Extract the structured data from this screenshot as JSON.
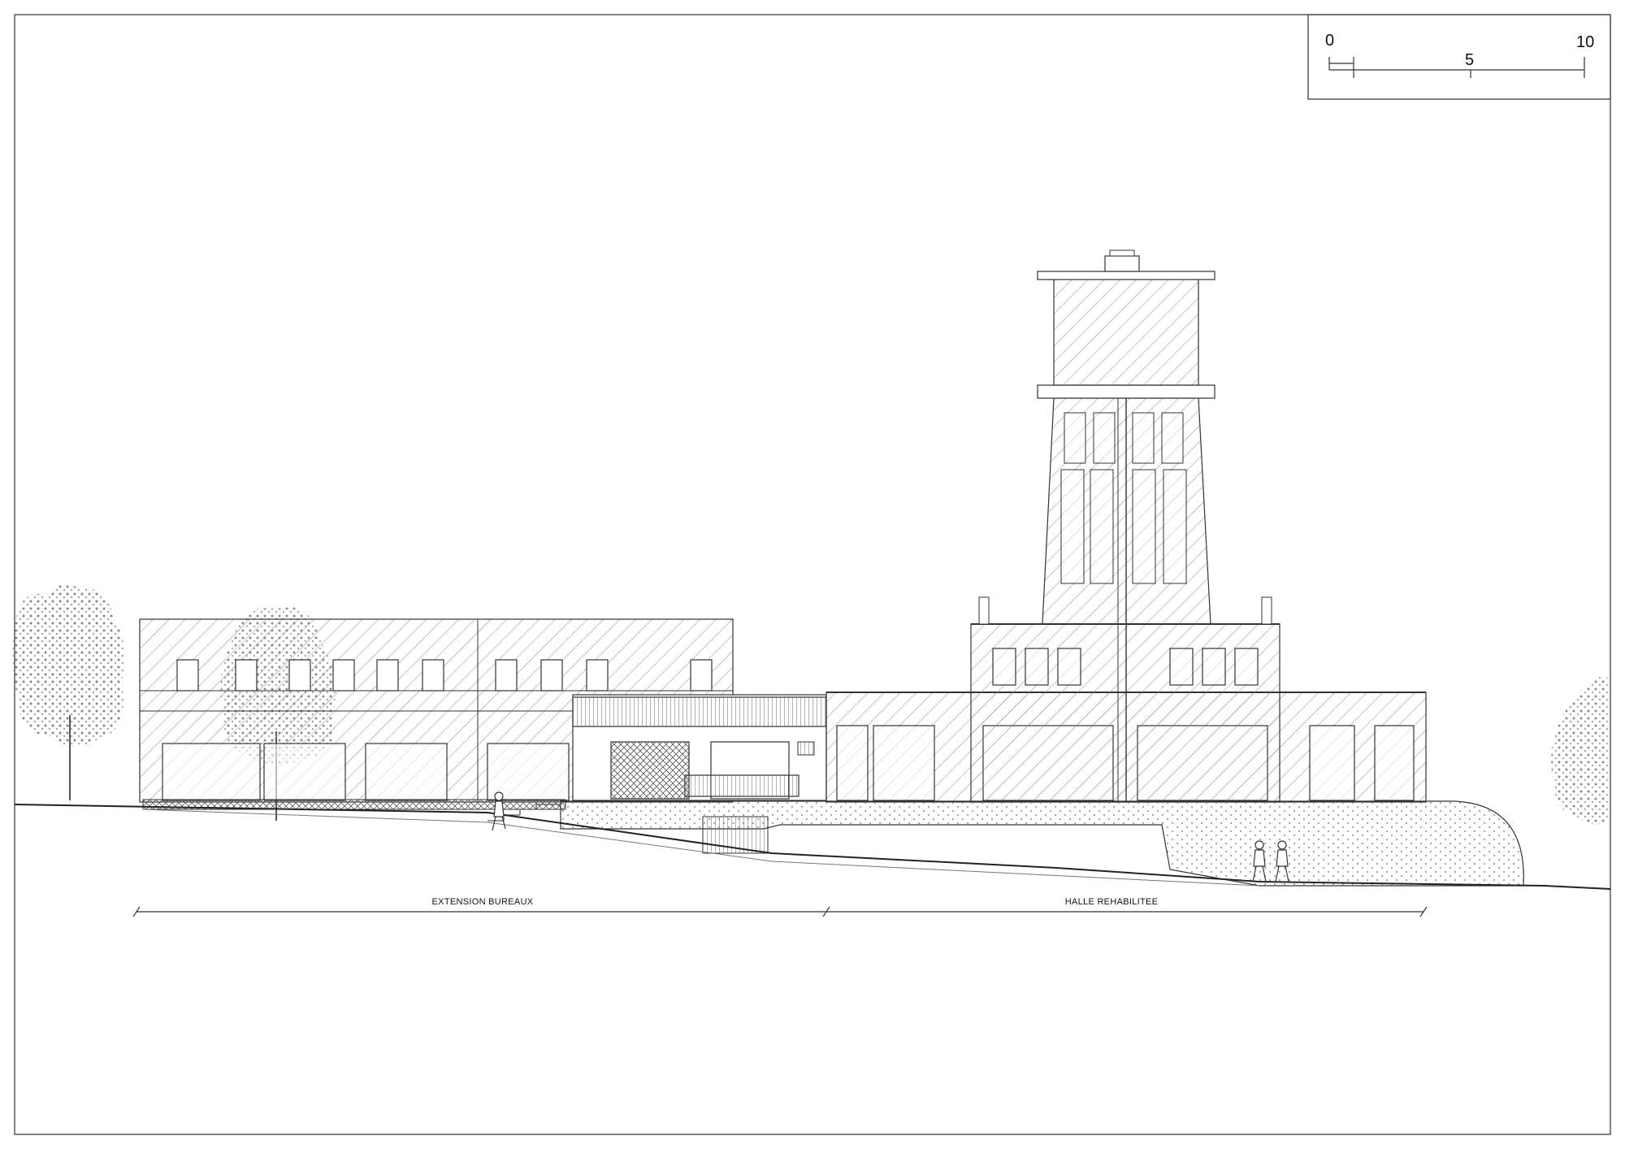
{
  "drawing": {
    "scale_bar": {
      "ticks": [
        "0",
        "5",
        "10"
      ]
    },
    "dimension_labels": {
      "left": "EXTENSION BUREAUX",
      "right": "HALLE REHABILITEE"
    }
  },
  "colors": {
    "line": "#222222",
    "hatch": "#777777",
    "tree": "#666666",
    "background": "#ffffff"
  }
}
